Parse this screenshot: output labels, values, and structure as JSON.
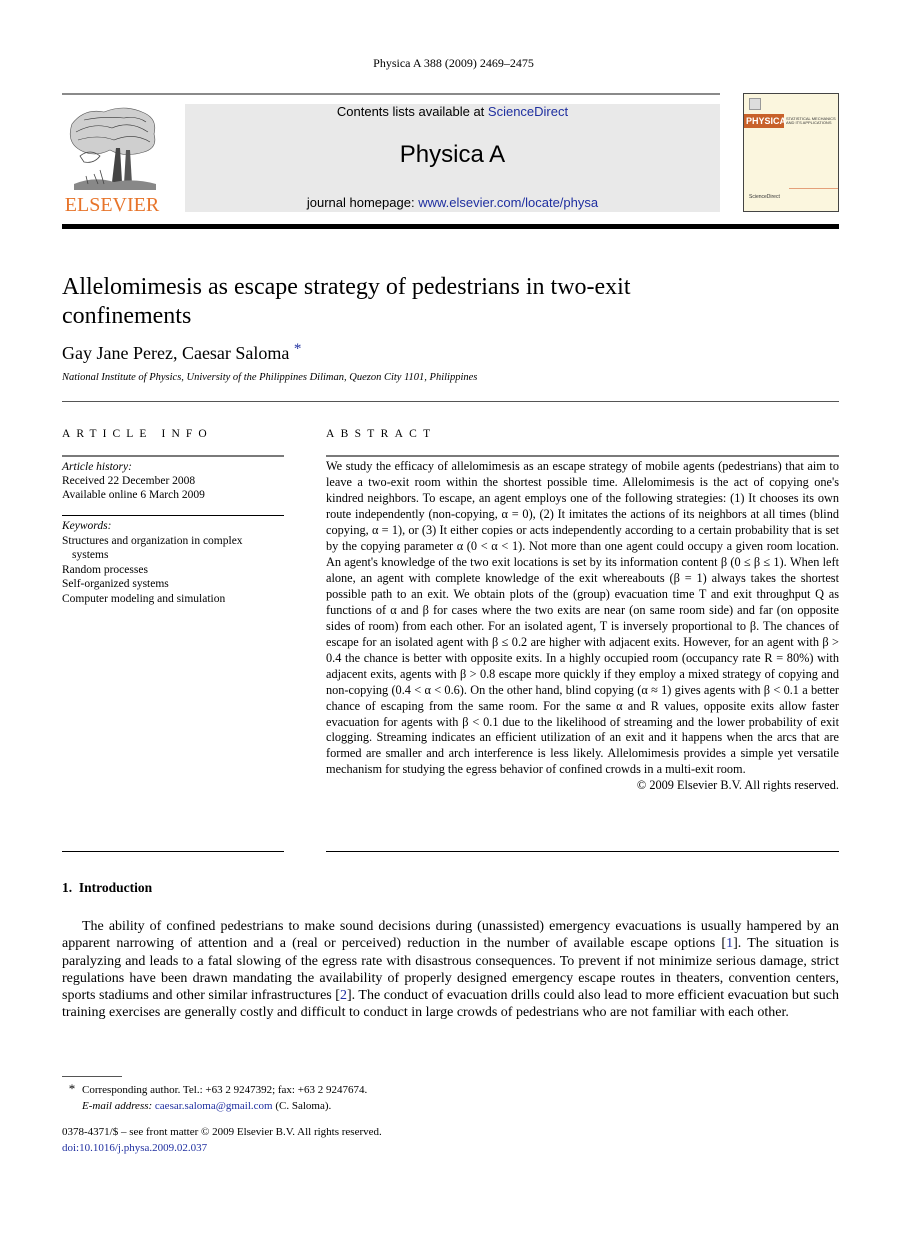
{
  "running_head": "Physica A 388 (2009) 2469–2475",
  "header": {
    "publisher_logo_text": "ELSEVIER",
    "contents_prefix": "Contents lists available at ",
    "contents_link": "ScienceDirect",
    "journal_title": "Physica A",
    "homepage_prefix": "journal homepage: ",
    "homepage_link": "www.elsevier.com/locate/physa",
    "cover_title": "PHYSICA",
    "cover_subtitle": "STATISTICAL MECHANICS AND ITS APPLICATIONS",
    "cover_footer": "ScienceDirect"
  },
  "colors": {
    "link": "#1f2fa0",
    "elsevier_orange": "#e7742a",
    "banner_gray": "#e9e9e9",
    "cover_orange": "#c8612a"
  },
  "article": {
    "title": "Allelomimesis as escape strategy of pedestrians in two-exit confinements",
    "authors": "Gay Jane Perez, Caesar Saloma",
    "corresponding_mark": "*",
    "affiliation": "National Institute of Physics, University of the Philippines Diliman, Quezon City 1101, Philippines"
  },
  "article_info": {
    "heading": "ARTICLE INFO",
    "history_label": "Article history:",
    "received": "Received 22 December 2008",
    "available": "Available online 6 March 2009",
    "keywords_label": "Keywords:",
    "keywords": [
      "Structures and organization in complex",
      "systems",
      "Random processes",
      "Self-organized systems",
      "Computer modeling and simulation"
    ]
  },
  "abstract": {
    "heading": "ABSTRACT",
    "text": "We study the efficacy of allelomimesis as an escape strategy of mobile agents (pedestrians) that aim to leave a two-exit room within the shortest possible time. Allelomimesis is the act of copying one's kindred neighbors. To escape, an agent employs one of the following strategies: (1) It chooses its own route independently (non-copying, α = 0), (2) It imitates the actions of its neighbors at all times (blind copying, α = 1), or (3) It either copies or acts independently according to a certain probability that is set by the copying parameter α (0 < α < 1). Not more than one agent could occupy a given room location. An agent's knowledge of the two exit locations is set by its information content β (0 ≤ β ≤ 1). When left alone, an agent with complete knowledge of the exit whereabouts (β = 1) always takes the shortest possible path to an exit. We obtain plots of the (group) evacuation time T and exit throughput Q as functions of α and β for cases where the two exits are near (on same room side) and far (on opposite sides of room) from each other. For an isolated agent, T is inversely proportional to β. The chances of escape for an isolated agent with β ≤ 0.2 are higher with adjacent exits. However, for an agent with β > 0.4 the chance is better with opposite exits. In a highly occupied room (occupancy rate R = 80%) with adjacent exits, agents with β > 0.8 escape more quickly if they employ a mixed strategy of copying and non-copying (0.4 < α < 0.6). On the other hand, blind copying (α ≈ 1) gives agents with β < 0.1 a better chance of escaping from the same room. For the same α and R values, opposite exits allow faster evacuation for agents with β < 0.1 due to the likelihood of streaming and the lower probability of exit clogging. Streaming indicates an efficient utilization of an exit and it happens when the arcs that are formed are smaller and arch interference is less likely. Allelomimesis provides a simple yet versatile mechanism for studying the egress behavior of confined crowds in a multi-exit room.",
    "copyright": "© 2009 Elsevier B.V. All rights reserved."
  },
  "introduction": {
    "heading": "1.  Introduction",
    "p1_a": "The ability of confined pedestrians to make sound decisions during (unassisted) emergency evacuations is usually hampered by an apparent narrowing of attention and a (real or perceived) reduction in the number of available escape options [",
    "ref1": "1",
    "p1_b": "]. The situation is paralyzing and leads to a fatal slowing of the egress rate with disastrous consequences. To prevent if not minimize serious damage, strict regulations have been drawn mandating the availability of properly designed emergency escape routes in theaters, convention centers, sports stadiums and other similar infrastructures [",
    "ref2": "2",
    "p1_c": "]. The conduct of evacuation drills could also lead to more efficient evacuation but such training exercises are generally costly and difficult to conduct in large crowds of pedestrians who are not familiar with each other."
  },
  "footnote": {
    "star": "*",
    "corresponding": "Corresponding author. Tel.: +63 2 9247392; fax: +63 2 9247674.",
    "email_label": "E-mail address: ",
    "email": "caesar.saloma@gmail.com",
    "email_suffix": " (C. Saloma)."
  },
  "front_matter": {
    "issn_line": "0378-4371/$ – see front matter © 2009 Elsevier B.V. All rights reserved.",
    "doi": "doi:10.1016/j.physa.2009.02.037"
  }
}
